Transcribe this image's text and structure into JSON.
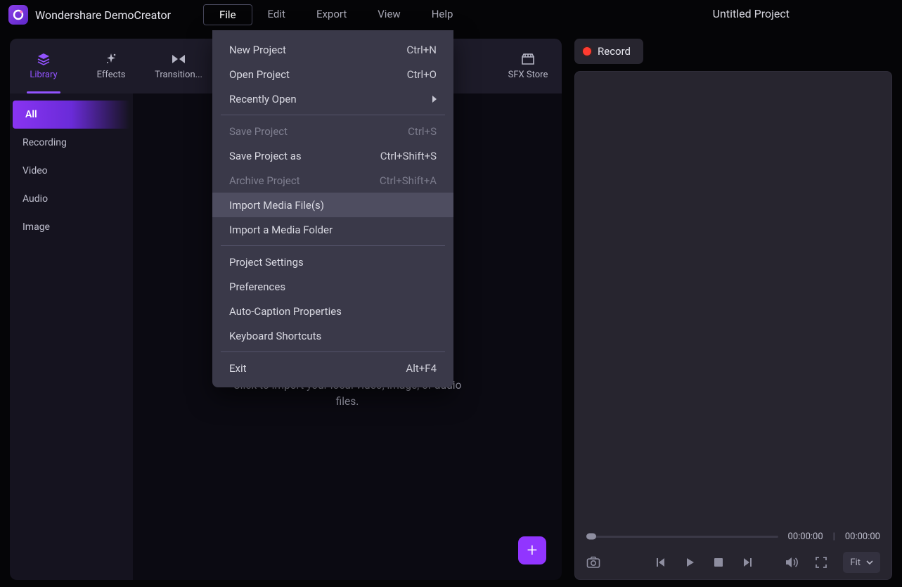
{
  "app": {
    "title": "Wondershare DemoCreator"
  },
  "project": {
    "title": "Untitled Project"
  },
  "menubar": {
    "items": [
      {
        "label": "File",
        "active": true
      },
      {
        "label": "Edit"
      },
      {
        "label": "Export"
      },
      {
        "label": "View"
      },
      {
        "label": "Help"
      }
    ]
  },
  "tabs": [
    {
      "label": "Library",
      "icon": "layers"
    },
    {
      "label": "Effects",
      "icon": "sparkle"
    },
    {
      "label": "Transition...",
      "icon": "bowtie"
    },
    {
      "label": "SFX Store",
      "icon": "store"
    }
  ],
  "sidebar": {
    "items": [
      {
        "label": "All",
        "active": true
      },
      {
        "label": "Recording"
      },
      {
        "label": "Video"
      },
      {
        "label": "Audio"
      },
      {
        "label": "Image"
      }
    ]
  },
  "media_hint": "Click to import your local video, image, or audio files.",
  "file_menu": [
    {
      "label": "New Project",
      "shortcut": "Ctrl+N"
    },
    {
      "label": "Open Project",
      "shortcut": "Ctrl+O"
    },
    {
      "label": "Recently Open",
      "submenu": true
    },
    {
      "sep": true
    },
    {
      "label": "Save Project",
      "shortcut": "Ctrl+S",
      "disabled": true
    },
    {
      "label": "Save Project as",
      "shortcut": "Ctrl+Shift+S"
    },
    {
      "label": "Archive Project",
      "shortcut": "Ctrl+Shift+A",
      "disabled": true
    },
    {
      "label": "Import Media File(s)",
      "hovered": true
    },
    {
      "label": "Import a Media Folder"
    },
    {
      "sep": true
    },
    {
      "label": "Project Settings"
    },
    {
      "label": "Preferences"
    },
    {
      "label": "Auto-Caption Properties"
    },
    {
      "label": "Keyboard Shortcuts"
    },
    {
      "sep": true
    },
    {
      "label": "Exit",
      "shortcut": "Alt+F4"
    }
  ],
  "preview": {
    "record_label": "Record",
    "time_current": "00:00:00",
    "time_total": "00:00:00",
    "fit_label": "Fit"
  }
}
